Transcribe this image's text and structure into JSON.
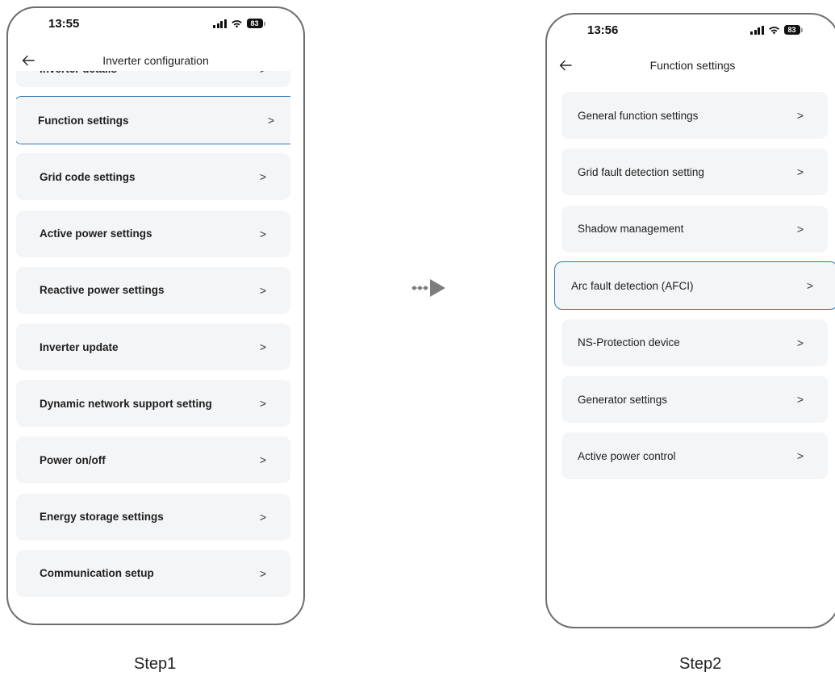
{
  "step1": {
    "label": "Step1",
    "status": {
      "time": "13:55",
      "battery": "83"
    },
    "title": "Inverter configuration",
    "items": [
      {
        "label": "Inverter details",
        "chevron": ">"
      },
      {
        "label": "Function settings",
        "chevron": ">",
        "highlighted": true
      },
      {
        "label": "Grid code settings",
        "chevron": ">"
      },
      {
        "label": "Active power settings",
        "chevron": ">"
      },
      {
        "label": "Reactive power settings",
        "chevron": ">"
      },
      {
        "label": "Inverter update",
        "chevron": ">"
      },
      {
        "label": "Dynamic network support setting",
        "chevron": ">"
      },
      {
        "label": "Power on/off",
        "chevron": ">"
      },
      {
        "label": "Energy storage settings",
        "chevron": ">"
      },
      {
        "label": "Communication setup",
        "chevron": ">"
      }
    ]
  },
  "step2": {
    "label": "Step2",
    "status": {
      "time": "13:56",
      "battery": "83"
    },
    "title": "Function settings",
    "items": [
      {
        "label": "General function settings",
        "chevron": ">"
      },
      {
        "label": "Grid fault detection setting",
        "chevron": ">"
      },
      {
        "label": "Shadow management",
        "chevron": ">"
      },
      {
        "label": "Arc fault detection (AFCI)",
        "chevron": ">",
        "highlighted": true
      },
      {
        "label": "NS-Protection device",
        "chevron": ">"
      },
      {
        "label": "Generator settings",
        "chevron": ">"
      },
      {
        "label": "Active power control",
        "chevron": ">"
      }
    ]
  },
  "colors": {
    "highlight": "#2f76b5",
    "item_bg": "#f4f5f7",
    "frame": "#6e6e6e"
  },
  "icons": {
    "back": "arrow-left-icon",
    "item": "chevron-right-icon",
    "flow": "dotted-arrow-icon"
  }
}
